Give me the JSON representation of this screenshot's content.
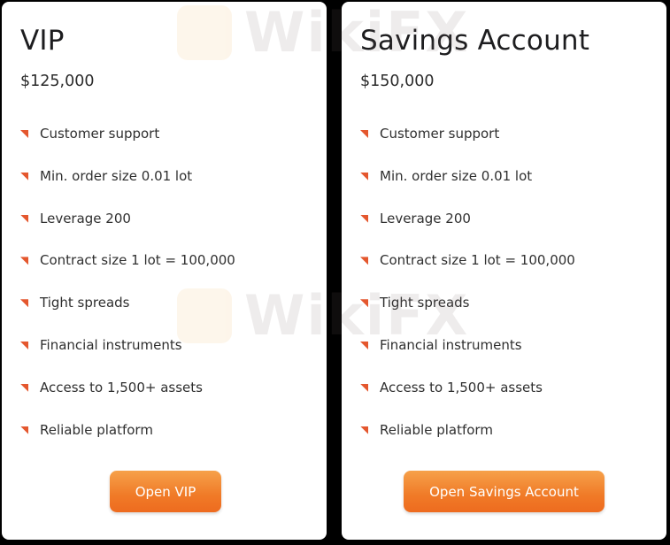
{
  "accent_color": "#e4572e",
  "button_color": "#f07a27",
  "watermark_text": "WikiFX",
  "cards": [
    {
      "title": "VIP",
      "price": "$125,000",
      "features": [
        "Customer support",
        "Min. order size 0.01 lot",
        "Leverage 200",
        "Contract size 1 lot = 100,000",
        "Tight spreads",
        "Financial instruments",
        "Access to 1,500+ assets",
        "Reliable platform"
      ],
      "button_label": "Open VIP"
    },
    {
      "title": "Savings Account",
      "price": "$150,000",
      "features": [
        "Customer support",
        "Min. order size 0.01 lot",
        "Leverage 200",
        "Contract size 1 lot = 100,000",
        "Tight spreads",
        "Financial instruments",
        "Access to 1,500+ assets",
        "Reliable platform"
      ],
      "button_label": "Open Savings Account"
    }
  ]
}
